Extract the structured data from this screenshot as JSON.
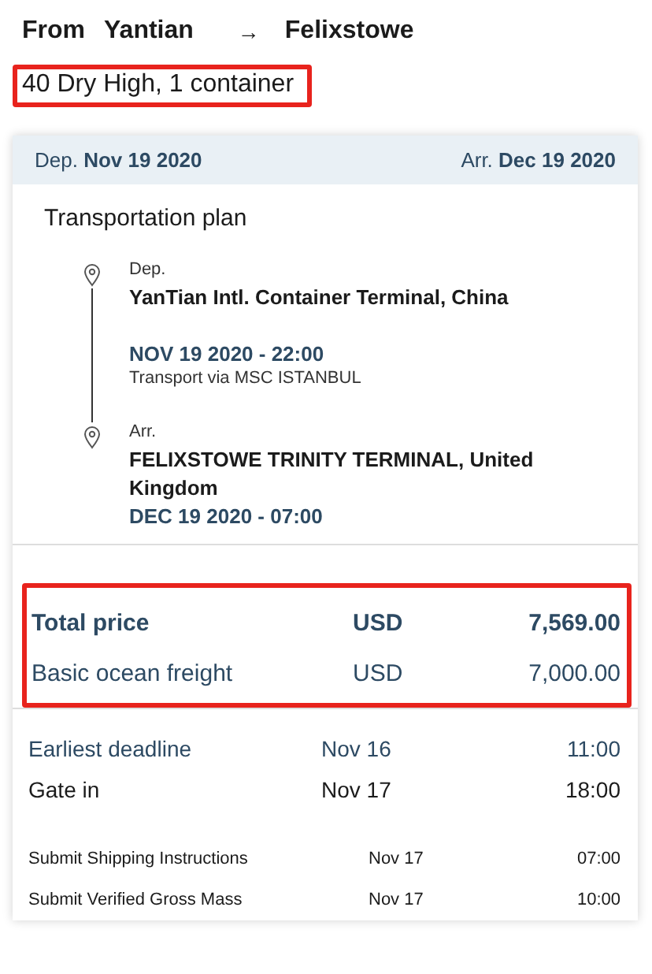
{
  "route": {
    "from_label": "From",
    "from": "Yantian",
    "arrow": "→",
    "to": "Felixstowe"
  },
  "equipment": "40 Dry High,  1 container",
  "card": {
    "departure": {
      "label": "Dep.",
      "date": "Nov 19 2020"
    },
    "arrival": {
      "label": "Arr.",
      "date": "Dec 19 2020"
    },
    "plan_title": "Transportation plan",
    "stops": [
      {
        "label": "Dep.",
        "location": "YanTian Intl. Container Terminal, China",
        "datetime": "NOV 19 2020 - 22:00",
        "note": "Transport via MSC ISTANBUL"
      },
      {
        "label": "Arr.",
        "location": "FELIXSTOWE TRINITY TERMINAL, United Kingdom",
        "datetime": "DEC 19 2020 - 07:00"
      }
    ],
    "prices": [
      {
        "kind": "total",
        "label": "Total price",
        "currency": "USD",
        "amount": "7,569.00"
      },
      {
        "kind": "item",
        "label": "Basic ocean freight",
        "currency": "USD",
        "amount": "7,000.00"
      }
    ],
    "deadlines": [
      {
        "kind": "highlight",
        "label": "Earliest deadline",
        "date": "Nov 16",
        "time": "11:00"
      },
      {
        "kind": "main",
        "label": "Gate in",
        "date": "Nov 17",
        "time": "18:00"
      },
      {
        "kind": "small",
        "label": "Submit Shipping Instructions",
        "date": "Nov 17",
        "time": "07:00"
      },
      {
        "kind": "small",
        "label": "Submit Verified Gross Mass",
        "date": "Nov 17",
        "time": "10:00"
      }
    ]
  }
}
